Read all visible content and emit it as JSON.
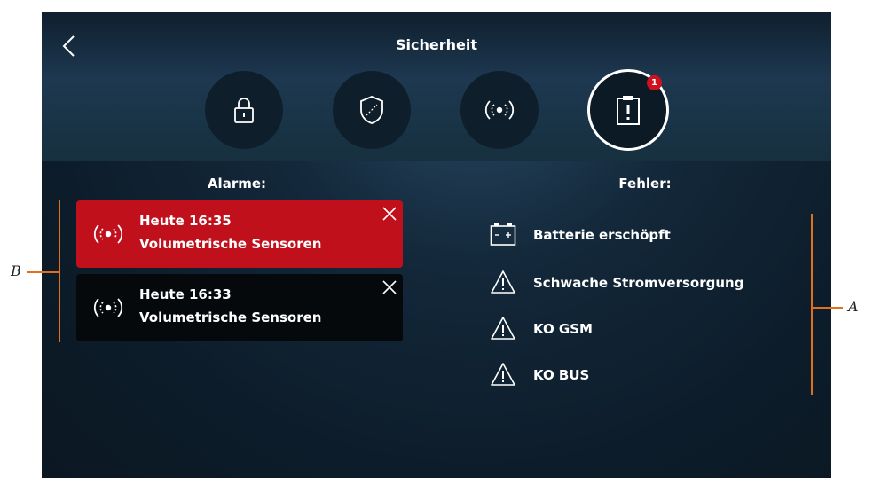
{
  "header": {
    "title": "Sicherheit"
  },
  "tabs": [
    {
      "icon": "lock-icon"
    },
    {
      "icon": "shield-icon"
    },
    {
      "icon": "sensor-icon"
    },
    {
      "icon": "alert-clipboard-icon",
      "active": true,
      "badge": "1"
    }
  ],
  "alarms": {
    "title": "Alarme:",
    "items": [
      {
        "time": "Heute 16:35",
        "name": "Volumetrische Sensoren",
        "color": "#c0101c"
      },
      {
        "time": "Heute 16:33",
        "name": "Volumetrische Sensoren",
        "color": "#05090c"
      }
    ]
  },
  "errors": {
    "title": "Fehler:",
    "items": [
      {
        "icon": "battery-icon",
        "label": "Batterie erschöpft"
      },
      {
        "icon": "warning-icon",
        "label": "Schwache Stromversorgung"
      },
      {
        "icon": "warning-icon",
        "label": "KO GSM"
      },
      {
        "icon": "warning-icon",
        "label": "KO BUS"
      }
    ]
  },
  "callouts": {
    "left": "B",
    "right": "A"
  },
  "colors": {
    "accent": "#e0701e",
    "alarm_active": "#c0101c",
    "badge": "#d0101e"
  }
}
